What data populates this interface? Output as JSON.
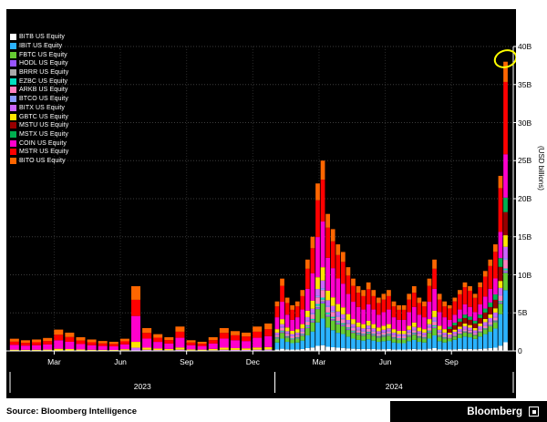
{
  "source_label": "Source: Bloomberg Intelligence",
  "brand": "Bloomberg",
  "colors": {
    "plot_background": "#000000",
    "page_background": "#ffffff",
    "grid": "#3c3c3c",
    "axis": "#ffffff",
    "annotation": "#ffff00"
  },
  "chart_data": {
    "type": "bar",
    "stacked": true,
    "title": "",
    "xlabel": "",
    "ylabel": "(USD billions)",
    "ylim": [
      0,
      40
    ],
    "xlim": [
      0,
      22.8
    ],
    "grid": "dotted",
    "legend_position": "top-left",
    "yticks": [
      {
        "v": 0,
        "label": "0"
      },
      {
        "v": 5,
        "label": "5B"
      },
      {
        "v": 10,
        "label": "10B"
      },
      {
        "v": 15,
        "label": "15B"
      },
      {
        "v": 20,
        "label": "20B"
      },
      {
        "v": 25,
        "label": "25B"
      },
      {
        "v": 30,
        "label": "30B"
      },
      {
        "v": 35,
        "label": "35B"
      },
      {
        "v": 40,
        "label": "40B"
      }
    ],
    "xticks": [
      {
        "m": 2,
        "label": "Mar"
      },
      {
        "m": 5,
        "label": "Jun"
      },
      {
        "m": 8,
        "label": "Sep"
      },
      {
        "m": 11,
        "label": "Dec"
      },
      {
        "m": 14,
        "label": "Mar"
      },
      {
        "m": 17,
        "label": "Jun"
      },
      {
        "m": 20,
        "label": "Sep"
      }
    ],
    "year_labels": [
      {
        "label": "2023",
        "from": 0,
        "to": 12
      },
      {
        "label": "2024",
        "from": 12,
        "to": 22.8
      }
    ],
    "x_months": [
      0.2,
      0.7,
      1.2,
      1.7,
      2.2,
      2.7,
      3.2,
      3.7,
      4.2,
      4.7,
      5.2,
      5.7,
      6.2,
      6.7,
      7.2,
      7.7,
      8.2,
      8.7,
      9.2,
      9.7,
      10.2,
      10.7,
      11.2,
      11.7,
      12.1,
      12.33,
      12.56,
      12.79,
      13.02,
      13.25,
      13.48,
      13.71,
      13.94,
      14.17,
      14.4,
      14.63,
      14.86,
      15.09,
      15.32,
      15.55,
      15.78,
      16.01,
      16.24,
      16.47,
      16.7,
      16.93,
      17.16,
      17.39,
      17.62,
      17.85,
      18.08,
      18.31,
      18.54,
      18.77,
      19.0,
      19.23,
      19.46,
      19.69,
      19.92,
      20.15,
      20.38,
      20.61,
      20.84,
      21.07,
      21.3,
      21.53,
      21.76,
      21.99,
      22.22,
      22.45
    ],
    "totals": [
      1.6,
      1.4,
      1.5,
      1.7,
      2.8,
      2.4,
      1.8,
      1.5,
      1.3,
      1.2,
      1.6,
      8.5,
      3.0,
      2.2,
      1.8,
      3.2,
      1.4,
      1.2,
      1.8,
      3.0,
      2.6,
      2.4,
      3.2,
      3.6,
      6.5,
      9.5,
      7.0,
      6.0,
      6.5,
      8.0,
      12.0,
      15.0,
      22.0,
      25.0,
      18.0,
      16.0,
      14.0,
      13.0,
      11.0,
      9.5,
      8.5,
      8.0,
      9.0,
      8.0,
      7.0,
      7.5,
      8.0,
      6.5,
      6.0,
      6.0,
      7.5,
      8.5,
      7.0,
      6.5,
      9.5,
      12.0,
      7.5,
      6.5,
      6.0,
      7.0,
      8.0,
      9.0,
      8.5,
      7.5,
      9.0,
      10.5,
      12.0,
      14.0,
      23.0,
      38.0
    ],
    "share_periods": [
      {
        "key": "a",
        "from": 0,
        "to": 9
      },
      {
        "key": "b",
        "from": 10,
        "to": 23
      },
      {
        "key": "c",
        "from": 24,
        "to": 57
      },
      {
        "key": "d",
        "from": 58,
        "to": 69
      }
    ],
    "series": [
      {
        "name": "BITB US Equity",
        "color": "#ffffff",
        "shares": {
          "c": 0.03,
          "d": 0.03
        }
      },
      {
        "name": "IBIT US Equity",
        "color": "#2bb3ff",
        "shares": {
          "c": 0.14,
          "d": 0.18
        }
      },
      {
        "name": "FBTC US Equity",
        "color": "#66cc33",
        "shares": {
          "c": 0.08,
          "d": 0.06
        }
      },
      {
        "name": "HODL US Equity",
        "color": "#9955ff",
        "shares": {
          "c": 0.01,
          "d": 0.005
        }
      },
      {
        "name": "BRRR US Equity",
        "color": "#aaaaaa",
        "shares": {
          "c": 0.01,
          "d": 0.005
        }
      },
      {
        "name": "EZBC US Equity",
        "color": "#00e0c0",
        "shares": {
          "c": 0.01,
          "d": 0.005
        }
      },
      {
        "name": "ARKB US Equity",
        "color": "#ff80bf",
        "shares": {
          "c": 0.04,
          "d": 0.03
        }
      },
      {
        "name": "BTCO US Equity",
        "color": "#8899ff",
        "shares": {
          "c": 0.01,
          "d": 0.005
        }
      },
      {
        "name": "BITX US Equity",
        "color": "#cc66ff",
        "shares": {
          "b": 0.05,
          "c": 0.04,
          "d": 0.04
        }
      },
      {
        "name": "GBTC US Equity",
        "color": "#ffe500",
        "shares": {
          "a": 0.1,
          "b": 0.09,
          "c": 0.07,
          "d": 0.04
        }
      },
      {
        "name": "MSTU US Equity",
        "color": "#990000",
        "shares": {
          "d": 0.08
        }
      },
      {
        "name": "MSTX US Equity",
        "color": "#00b050",
        "shares": {
          "d": 0.05
        }
      },
      {
        "name": "COIN US Equity",
        "color": "#ff00cc",
        "shares": {
          "a": 0.4,
          "b": 0.4,
          "c": 0.24,
          "d": 0.15
        }
      },
      {
        "name": "MSTR US Equity",
        "color": "#ff0000",
        "shares": {
          "a": 0.26,
          "b": 0.25,
          "c": 0.22,
          "d": 0.25
        }
      },
      {
        "name": "BITO US Equity",
        "color": "#ff6600",
        "shares": {
          "a": 0.24,
          "b": 0.21,
          "c": 0.1,
          "d": 0.07
        }
      }
    ],
    "annotation": {
      "shape": "ellipse",
      "point_index": 69,
      "value": 38,
      "color": "#ffff00"
    }
  }
}
